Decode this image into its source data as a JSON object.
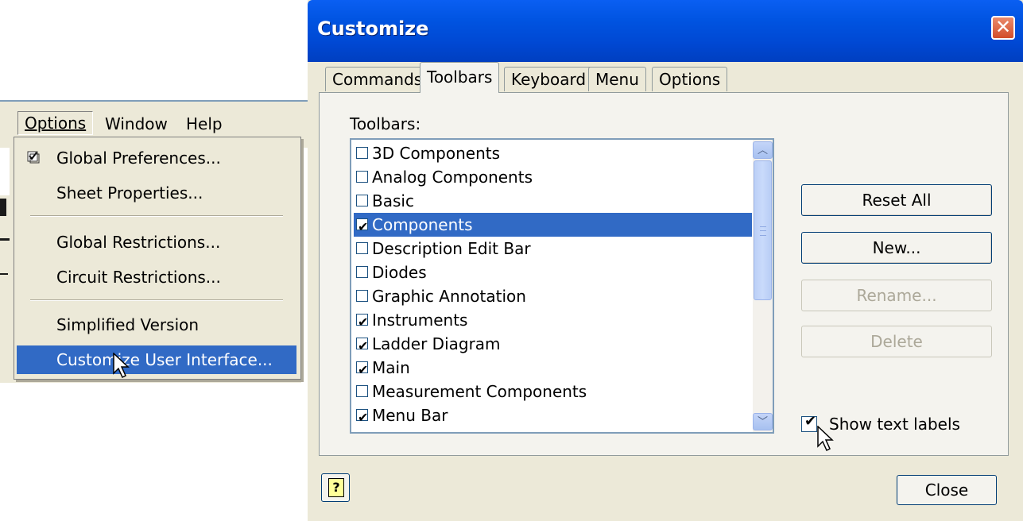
{
  "menubar": {
    "items": [
      {
        "label": "Options"
      },
      {
        "label": "Window"
      },
      {
        "label": "Help"
      }
    ]
  },
  "options_menu": {
    "items": [
      {
        "label": "Global Preferences...",
        "icon": "global-preferences-icon"
      },
      {
        "label": "Sheet Properties..."
      },
      {
        "label": "Global Restrictions..."
      },
      {
        "label": "Circuit Restrictions..."
      },
      {
        "label": "Simplified Version"
      },
      {
        "label": "Customize User Interface...",
        "highlighted": true
      }
    ]
  },
  "dialog": {
    "title": "Customize",
    "tabs": [
      {
        "label": "Commands"
      },
      {
        "label": "Toolbars",
        "active": true
      },
      {
        "label": "Keyboard"
      },
      {
        "label": "Menu"
      },
      {
        "label": "Options"
      }
    ],
    "list_label": "Toolbars:",
    "toolbars": [
      {
        "label": "3D Components",
        "checked": false
      },
      {
        "label": "Analog Components",
        "checked": false
      },
      {
        "label": "Basic",
        "checked": false
      },
      {
        "label": "Components",
        "checked": true,
        "selected": true
      },
      {
        "label": "Description Edit Bar",
        "checked": false
      },
      {
        "label": "Diodes",
        "checked": false
      },
      {
        "label": "Graphic Annotation",
        "checked": false
      },
      {
        "label": "Instruments",
        "checked": true
      },
      {
        "label": "Ladder Diagram",
        "checked": true
      },
      {
        "label": "Main",
        "checked": true
      },
      {
        "label": "Measurement Components",
        "checked": false
      },
      {
        "label": "Menu Bar",
        "checked": true
      }
    ],
    "buttons": {
      "reset_all": "Reset All",
      "new": "New...",
      "rename": "Rename...",
      "delete": "Delete",
      "close": "Close",
      "help": "?"
    },
    "show_text_labels": {
      "label": "Show text labels",
      "checked": true
    }
  },
  "colors": {
    "title_bar": "#0054e3",
    "selection": "#316ac5",
    "face": "#ece9d8"
  }
}
